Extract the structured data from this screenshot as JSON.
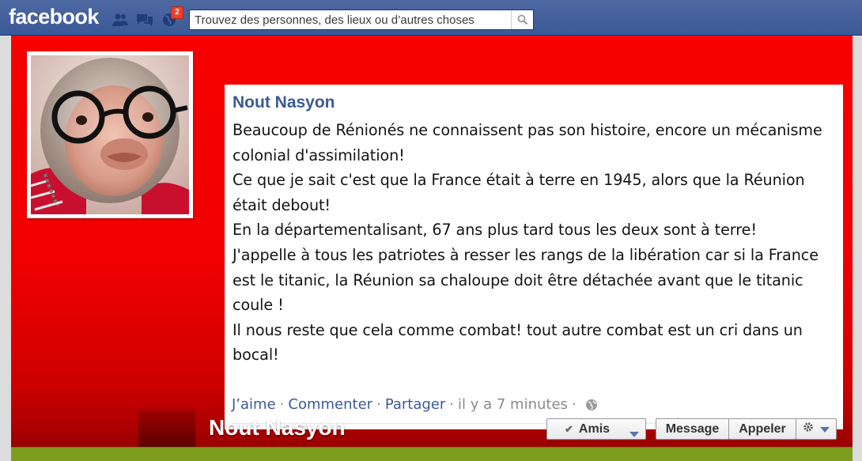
{
  "header": {
    "logo": "facebook",
    "notification_count": "2",
    "search": {
      "placeholder": "Trouvez des personnes, des lieux ou d’autres choses"
    }
  },
  "post": {
    "author": "Nout Nasyon",
    "text": "Beaucoup de Rénionés ne connaissent pas son histoire, encore un mécanisme colonial d'assimilation!\nCe que je sait c'est que la France était à terre en 1945, alors que la Réunion était debout!\nEn la départementalisant, 67 ans plus tard tous les deux sont à terre!\nJ'appelle à tous les patriotes à resser les rangs de la libération car si la France est le titanic, la Réunion sa chaloupe doit être détachée avant que le titanic coule !\nIl nous reste que cela comme combat! tout autre combat est un cri dans un bocal!",
    "actions": {
      "like": "J’aime",
      "comment": "Commenter",
      "share": "Partager",
      "time": "il y a 7 minutes"
    }
  },
  "profile": {
    "name": "Nout Nasyon",
    "buttons": {
      "friends": "Amis",
      "message": "Message",
      "call": "Appeler"
    }
  },
  "icons": {
    "friend_requests": "friends-icon",
    "messages": "messages-icon",
    "notifications": "globe-icon",
    "search": "search-icon",
    "privacy": "globe-icon",
    "settings": "gear-icon"
  },
  "colors": {
    "brand": "#3b5998",
    "cover": "#f00000",
    "link": "#3b5998",
    "badge": "#f03d25"
  }
}
